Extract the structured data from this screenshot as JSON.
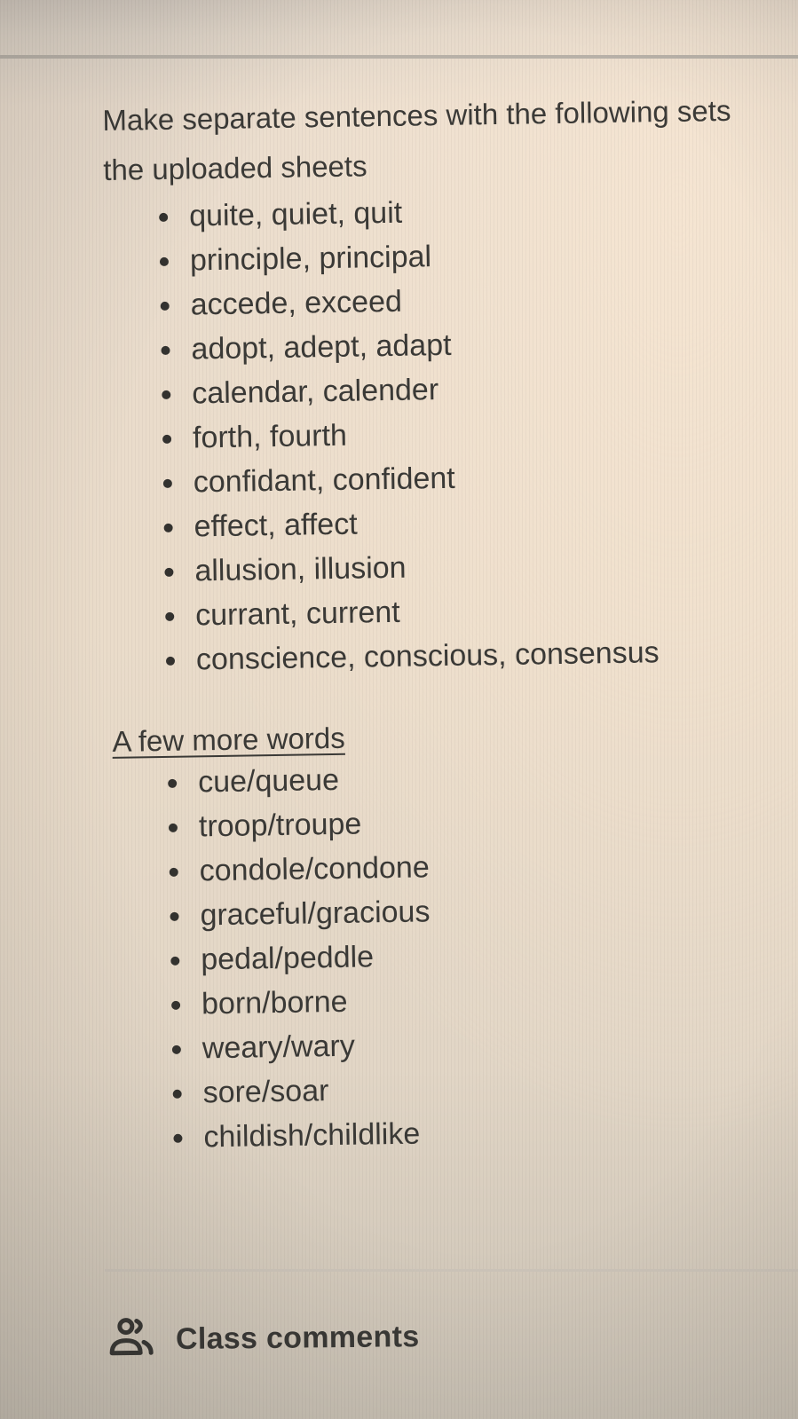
{
  "assignment": {
    "instructions_lines": [
      "Make separate sentences with the following sets",
      "the uploaded sheets"
    ],
    "word_sets": [
      "quite, quiet, quit",
      "principle, principal",
      "accede, exceed",
      "adopt, adept, adapt",
      "calendar, calender",
      "forth, fourth",
      "confidant, confident",
      "effect, affect",
      "allusion, illusion",
      "currant, current",
      "conscience, conscious, consensus"
    ],
    "more_words_heading": "A few more words",
    "more_words": [
      "cue/queue",
      "troop/troupe",
      "condole/condone",
      "graceful/gracious",
      "pedal/peddle",
      "born/borne",
      "weary/wary",
      "sore/soar",
      "childish/childlike"
    ]
  },
  "class_comments": {
    "label": "Class comments",
    "icon": "people-icon"
  }
}
